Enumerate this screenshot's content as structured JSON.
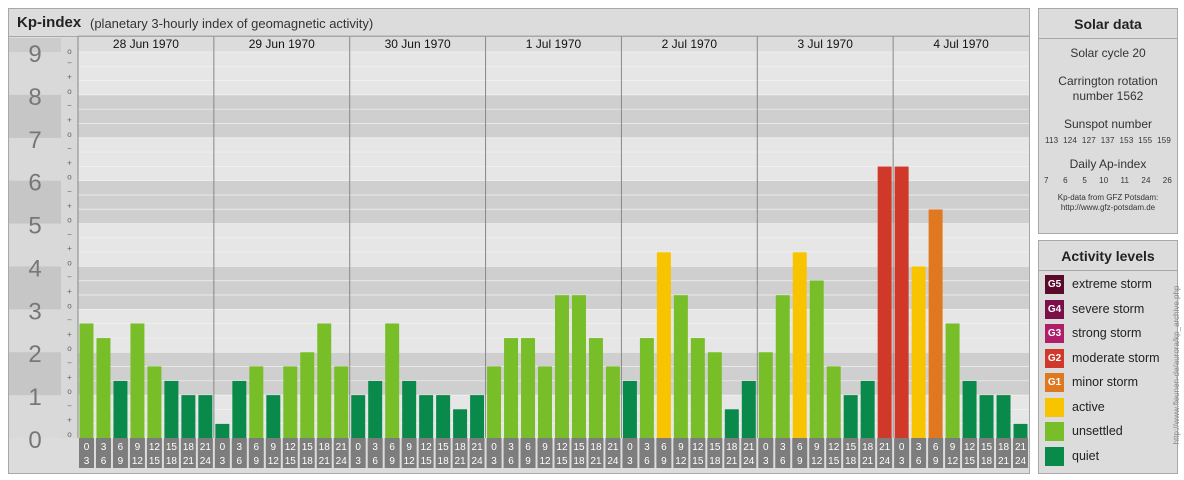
{
  "header": {
    "title": "Kp-index",
    "subtitle": "(planetary 3-hourly index of geomagnetic activity)"
  },
  "chart_data": {
    "type": "bar",
    "y_axis": {
      "ylim": [
        0,
        9
      ],
      "major_ticks": [
        "0",
        "1",
        "2",
        "3",
        "4",
        "5",
        "6",
        "7",
        "8",
        "9"
      ],
      "minor_marks": [
        "o",
        "+",
        "−"
      ]
    },
    "days": [
      "28 Jun 1970",
      "29 Jun 1970",
      "30 Jun 1970",
      "1 Jul 1970",
      "2 Jul 1970",
      "3 Jul 1970",
      "4 Jul 1970"
    ],
    "hour_labels": [
      [
        "0",
        "3"
      ],
      [
        "3",
        "6"
      ],
      [
        "6",
        "9"
      ],
      [
        "9",
        "12"
      ],
      [
        "12",
        "15"
      ],
      [
        "15",
        "18"
      ],
      [
        "18",
        "21"
      ],
      [
        "21",
        "24"
      ]
    ],
    "values": [
      [
        2.67,
        2.33,
        1.33,
        2.67,
        1.67,
        1.33,
        1.0,
        1.0
      ],
      [
        0.33,
        1.33,
        1.67,
        1.0,
        1.67,
        2.0,
        2.67,
        1.67
      ],
      [
        1.0,
        1.33,
        2.67,
        1.33,
        1.0,
        1.0,
        0.67,
        1.0
      ],
      [
        1.67,
        2.33,
        2.33,
        1.67,
        3.33,
        3.33,
        2.33,
        1.67
      ],
      [
        1.33,
        2.33,
        4.33,
        3.33,
        2.33,
        2.0,
        0.67,
        1.33
      ],
      [
        2.0,
        3.33,
        4.33,
        3.67,
        1.67,
        1.0,
        1.33,
        6.33
      ],
      [
        6.33,
        4.0,
        5.33,
        2.67,
        1.33,
        1.0,
        1.0,
        0.33
      ]
    ],
    "legend_placement": "right",
    "grid": true
  },
  "solar": {
    "title": "Solar data",
    "cycle": "Solar cycle 20",
    "rotation_line1": "Carrington rotation",
    "rotation_line2": "number 1562",
    "sunspot_title": "Sunspot number",
    "sunspot_values": "113  124  127  137  153  155  159",
    "ap_title": "Daily Ap-index",
    "ap_values": "7      6      5     10     11     24     26",
    "credit_line1": "Kp-data from  GFZ Potsdam:",
    "credit_line2": "http://www.gfz-potsdam.de"
  },
  "levels": {
    "title": "Activity levels",
    "items": [
      {
        "code": "G5",
        "label": "extreme storm",
        "color": "#5a0a2a"
      },
      {
        "code": "G4",
        "label": "severe storm",
        "color": "#7a0f4a"
      },
      {
        "code": "G3",
        "label": "strong storm",
        "color": "#b01e6a"
      },
      {
        "code": "G2",
        "label": "moderate storm",
        "color": "#d0382a"
      },
      {
        "code": "G1",
        "label": "minor storm",
        "color": "#e07820"
      },
      {
        "code": "",
        "label": "active",
        "color": "#f8c400"
      },
      {
        "code": "",
        "label": "unsettled",
        "color": "#78be28"
      },
      {
        "code": "",
        "label": "quiet",
        "color": "#0a8a4a"
      }
    ]
  },
  "watermark": "http://www.fleunen-de/aurora/kp_archive.php"
}
